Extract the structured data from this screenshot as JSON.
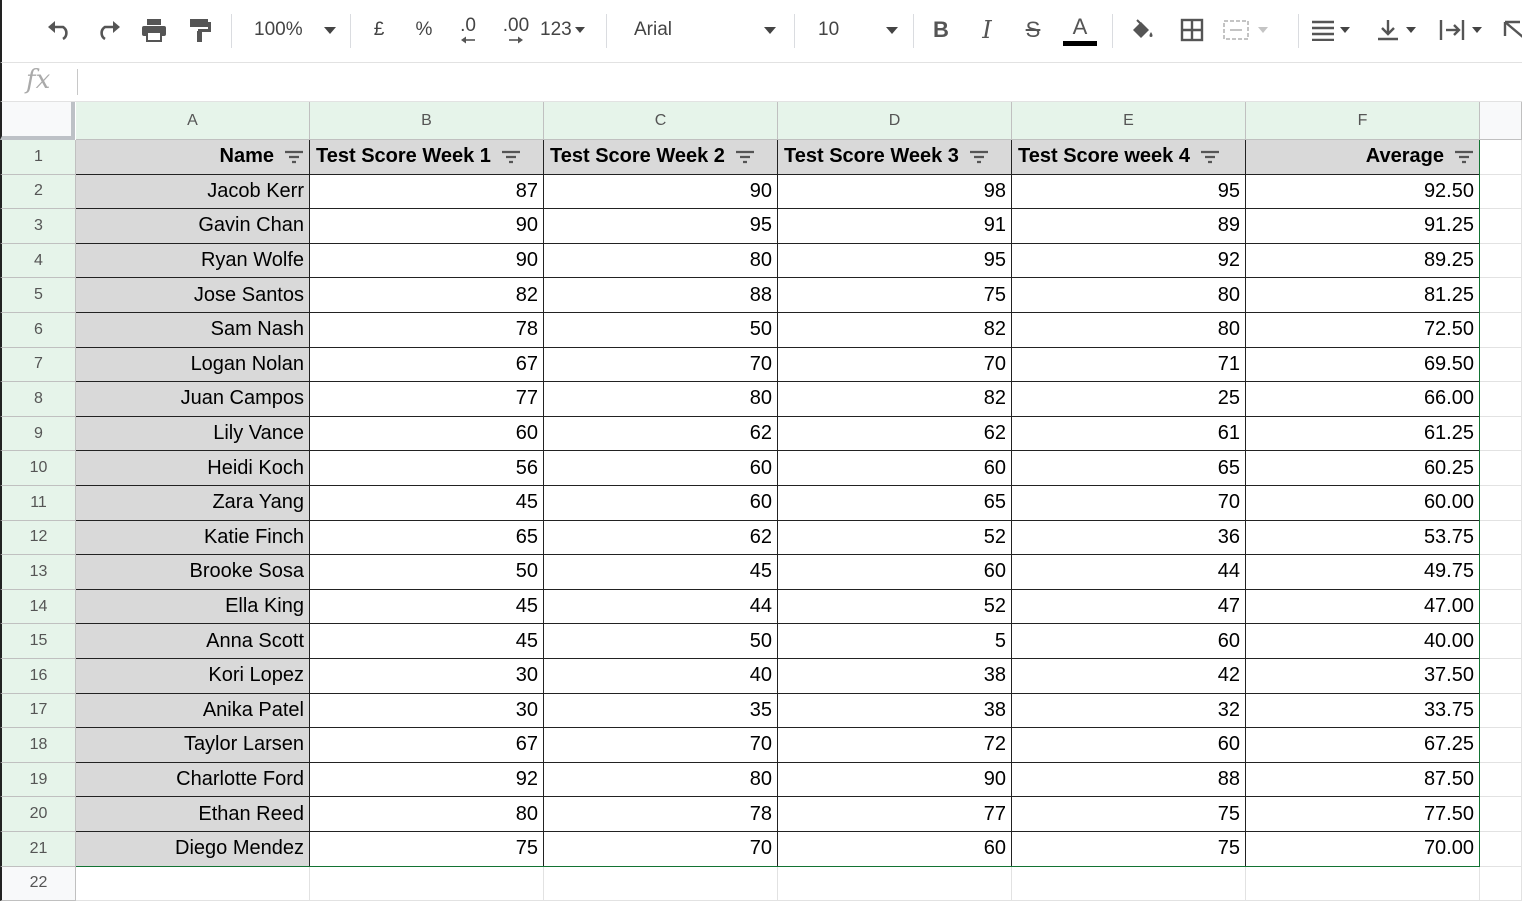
{
  "toolbar": {
    "zoom": "100%",
    "currency": "£",
    "percent": "%",
    "decrease_decimal": ".0",
    "increase_decimal": ".00",
    "more_formats": "123",
    "font": "Arial",
    "font_size": "10",
    "bold": "B",
    "italic": "I",
    "strikethrough": "S",
    "text_color": "A"
  },
  "formula_bar": {
    "label": "fx",
    "value": ""
  },
  "columns": [
    "A",
    "B",
    "C",
    "D",
    "E",
    "F"
  ],
  "headers": [
    "Name",
    "Test Score Week 1",
    "Test Score Week 2",
    "Test Score Week 3",
    "Test Score week 4",
    "Average"
  ],
  "rows": [
    [
      "Jacob Kerr",
      "87",
      "90",
      "98",
      "95",
      "92.50"
    ],
    [
      "Gavin Chan",
      "90",
      "95",
      "91",
      "89",
      "91.25"
    ],
    [
      "Ryan Wolfe",
      "90",
      "80",
      "95",
      "92",
      "89.25"
    ],
    [
      "Jose Santos",
      "82",
      "88",
      "75",
      "80",
      "81.25"
    ],
    [
      "Sam Nash",
      "78",
      "50",
      "82",
      "80",
      "72.50"
    ],
    [
      "Logan Nolan",
      "67",
      "70",
      "70",
      "71",
      "69.50"
    ],
    [
      "Juan Campos",
      "77",
      "80",
      "82",
      "25",
      "66.00"
    ],
    [
      "Lily Vance",
      "60",
      "62",
      "62",
      "61",
      "61.25"
    ],
    [
      "Heidi Koch",
      "56",
      "60",
      "60",
      "65",
      "60.25"
    ],
    [
      "Zara Yang",
      "45",
      "60",
      "65",
      "70",
      "60.00"
    ],
    [
      "Katie Finch",
      "65",
      "62",
      "52",
      "36",
      "53.75"
    ],
    [
      "Brooke Sosa",
      "50",
      "45",
      "60",
      "44",
      "49.75"
    ],
    [
      "Ella King",
      "45",
      "44",
      "52",
      "47",
      "47.00"
    ],
    [
      "Anna Scott",
      "45",
      "50",
      "5",
      "60",
      "40.00"
    ],
    [
      "Kori Lopez",
      "30",
      "40",
      "38",
      "42",
      "37.50"
    ],
    [
      "Anika Patel",
      "30",
      "35",
      "38",
      "32",
      "33.75"
    ],
    [
      "Taylor Larsen",
      "67",
      "70",
      "72",
      "60",
      "67.25"
    ],
    [
      "Charlotte Ford",
      "92",
      "80",
      "90",
      "88",
      "87.50"
    ],
    [
      "Ethan Reed",
      "80",
      "78",
      "77",
      "75",
      "77.50"
    ],
    [
      "Diego Mendez",
      "75",
      "70",
      "60",
      "75",
      "70.00"
    ]
  ],
  "row_numbers": [
    "1",
    "2",
    "3",
    "4",
    "5",
    "6",
    "7",
    "8",
    "9",
    "10",
    "11",
    "12",
    "13",
    "14",
    "15",
    "16",
    "17",
    "18",
    "19",
    "20",
    "21",
    "22"
  ],
  "colors": {
    "selected_header": "#e6f4ea",
    "header_fill": "#d9d9d9",
    "text_color_underline": "#000000"
  }
}
